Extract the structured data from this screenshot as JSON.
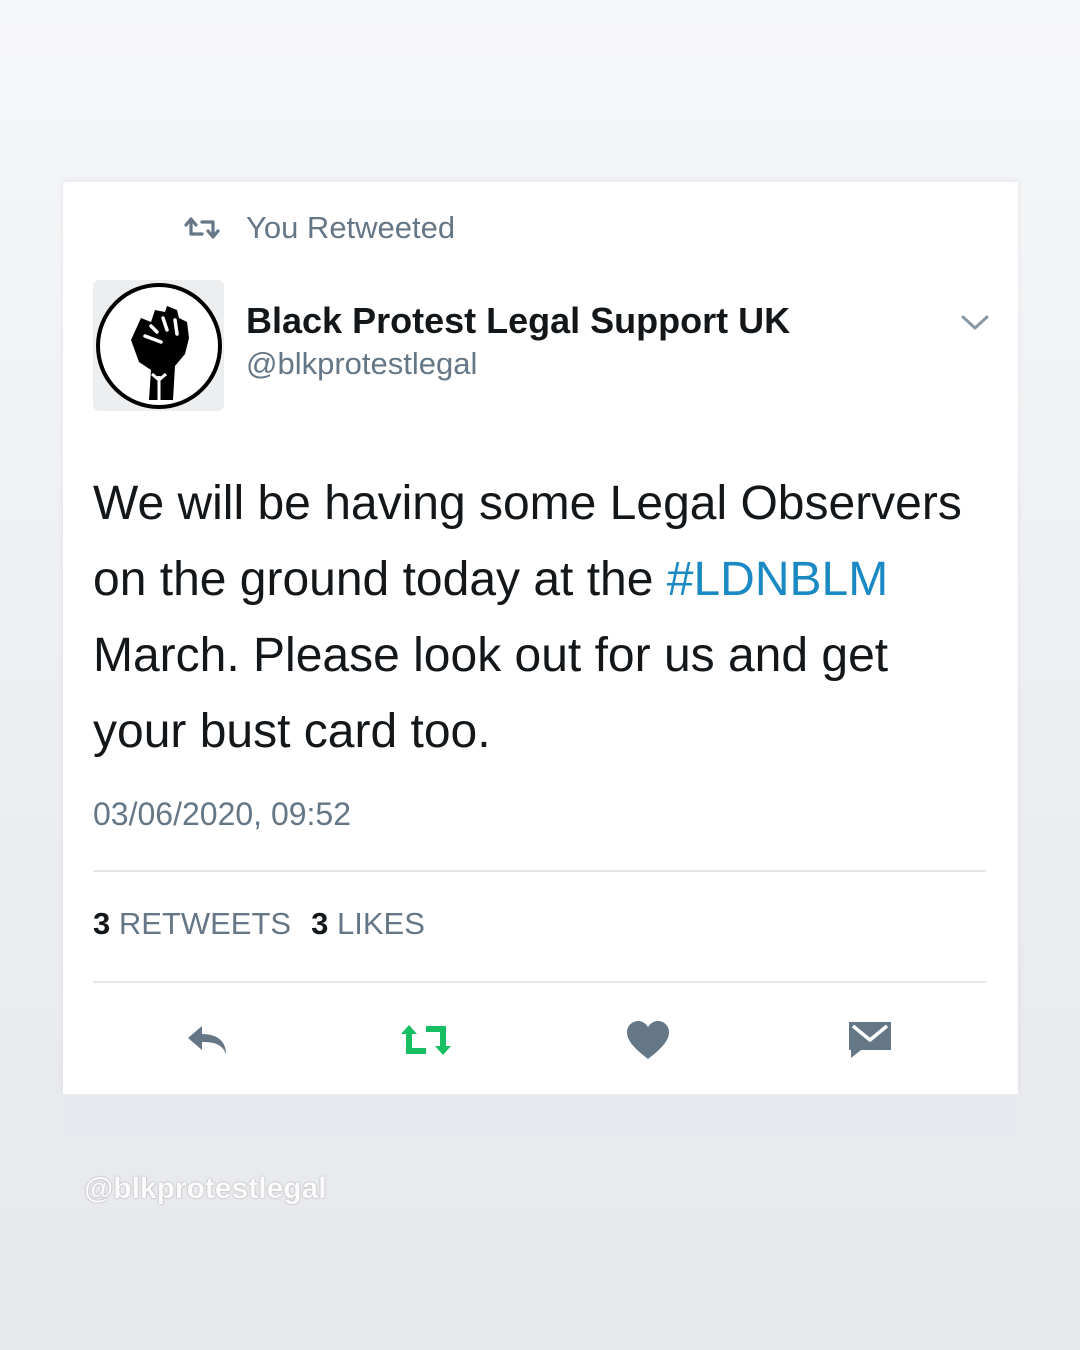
{
  "tweet": {
    "context_label": "You Retweeted",
    "author": {
      "name": "Black Protest Legal Support UK",
      "handle": "@blkprotestlegal",
      "avatar_icon": "raised-fist-icon"
    },
    "body": {
      "part1": "We will be having some Legal Observers on the ground today at the ",
      "hashtag": "#LDNBLM",
      "part2": " March. Please look out for us and get your bust card too."
    },
    "timestamp": "03/06/2020, 09:52",
    "stats": {
      "retweets_count": "3",
      "retweets_label": "RETWEETS",
      "likes_count": "3",
      "likes_label": "LIKES"
    },
    "actions": [
      {
        "name": "reply",
        "icon": "reply-icon"
      },
      {
        "name": "retweet",
        "icon": "retweet-icon",
        "active": true
      },
      {
        "name": "like",
        "icon": "heart-icon"
      },
      {
        "name": "message",
        "icon": "envelope-icon"
      }
    ]
  },
  "watermark": "@blkprotestlegal",
  "colors": {
    "hashtag": "#1b8ac4",
    "retweet_active": "#17bf63",
    "secondary_text": "#657786",
    "icon_gray": "#657786"
  }
}
